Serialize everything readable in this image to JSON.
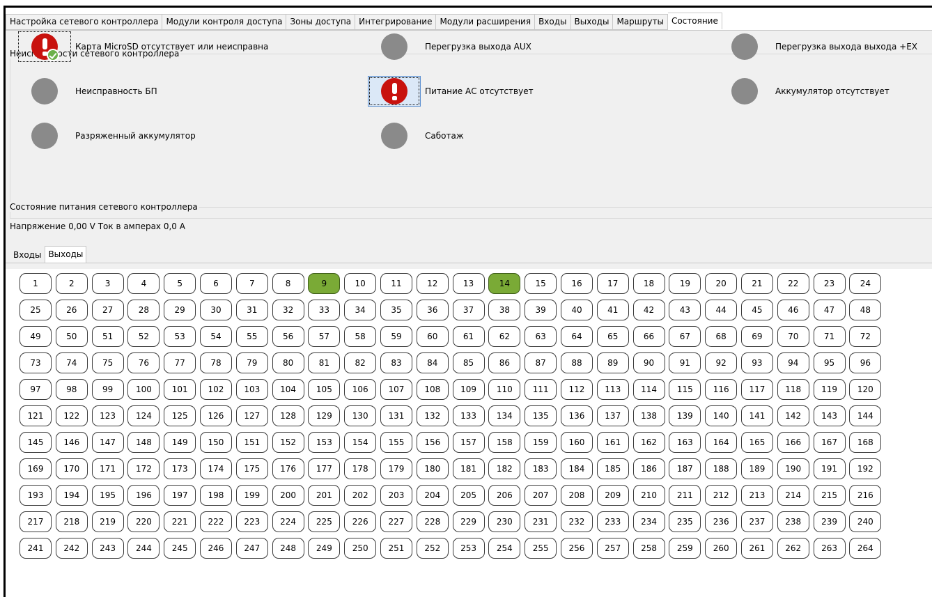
{
  "top_tabs": [
    {
      "label": "Настройка сетевого контроллера",
      "active": false
    },
    {
      "label": "Модули контроля доступа",
      "active": false
    },
    {
      "label": "Зоны доступа",
      "active": false
    },
    {
      "label": "Интегрирование",
      "active": false
    },
    {
      "label": "Модули расширения",
      "active": false
    },
    {
      "label": "Входы",
      "active": false
    },
    {
      "label": "Выходы",
      "active": false
    },
    {
      "label": "Маршруты",
      "active": false
    },
    {
      "label": "Состояние",
      "active": true
    }
  ],
  "faults": {
    "legend": "Неисправности сетевого контроллера",
    "items": [
      {
        "label": "Карта MicroSD отсутствует или неисправна",
        "icon": "alert-ok-icon",
        "state": "alert-acknowledged"
      },
      {
        "label": "Перегрузка выхода AUX",
        "icon": "grey-dot-icon",
        "state": "normal"
      },
      {
        "label": "Перегрузка выхода выхода +EX",
        "icon": "grey-dot-icon",
        "state": "normal"
      },
      {
        "label": "Неисправность БП",
        "icon": "grey-dot-icon",
        "state": "normal"
      },
      {
        "label": "Питание АС отсутствует",
        "icon": "alert-icon",
        "state": "alert"
      },
      {
        "label": "Аккумулятор отсутствует",
        "icon": "grey-dot-icon",
        "state": "normal"
      },
      {
        "label": "Разряженный аккумулятор",
        "icon": "grey-dot-icon",
        "state": "normal"
      },
      {
        "label": "Саботаж",
        "icon": "grey-dot-icon",
        "state": "normal"
      }
    ]
  },
  "power": {
    "legend": "Состояние питания сетевого контроллера",
    "voltage_label": "Напряжение",
    "voltage_value": "0,00",
    "voltage_unit": "V",
    "current_label": "Ток в амперах",
    "current_value": "0,0",
    "current_unit": "A"
  },
  "sub_tabs": [
    {
      "label": "Входы",
      "active": false
    },
    {
      "label": "Выходы",
      "active": true
    }
  ],
  "outputs": {
    "count": 264,
    "active": [
      9,
      14
    ],
    "active_color": "#7aaa36"
  }
}
